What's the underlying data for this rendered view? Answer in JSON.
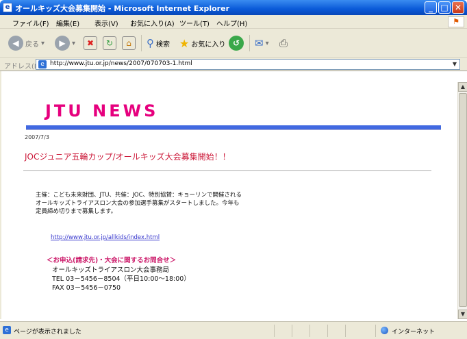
{
  "window": {
    "title": "オールキッズ大会募集開始 - Microsoft Internet Explorer",
    "minimize": "_",
    "maximize": "□",
    "close": "✕"
  },
  "menu": [
    "ファイル(F)",
    "編集(E)",
    "表示(V)",
    "お気に入り(A)",
    "ツール(T)",
    "ヘルプ(H)"
  ],
  "toolbar": {
    "back_label": "戻る",
    "search_label": "検索",
    "favorites_label": "お気に入り"
  },
  "address": {
    "label": "アドレス(D)",
    "url": "http://www.jtu.or.jp/news/2007/070703-1.html"
  },
  "page": {
    "site_title": "JTU NEWS",
    "date": "2007/7/3",
    "headline": "JOCジュニア五輪カップ/オールキッズ大会募集開始！！",
    "body": "主催：こども未来財団、JTU、共催：JOC、特別協賛：キョーリンで開催される\nオールキッズトライアスロン大会の参加選手募集がスタートしました。今年も\n定員締め切りまで募集します。",
    "link": "http://www.jtu.or.jp/allkids/index.html",
    "contact_title": "＜お申込(請求先)・大会に関するお問合せ＞",
    "contact_lines": [
      "オールキッズトライアスロン大会事務局",
      "TEL 03－5456－8504（平日10:00～18:00）",
      "FAX 03－5456－0750"
    ]
  },
  "status": {
    "text": "ページが表示されました",
    "zone": "インターネット"
  },
  "colors": {
    "title_pink": "#e6007e",
    "headline_red": "#cc1a3a",
    "bar_blue": "#4169e1",
    "titlebar_blue": "#0a5ad8"
  }
}
